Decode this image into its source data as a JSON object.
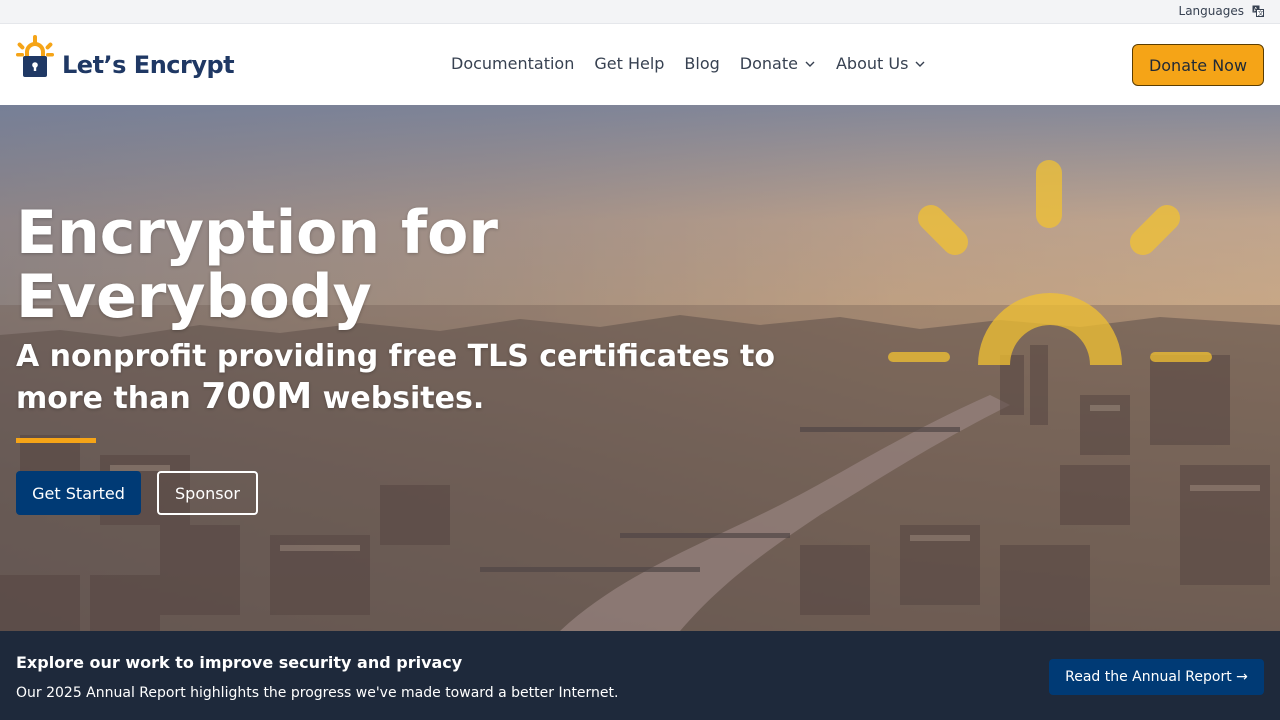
{
  "topbar": {
    "languages_label": "Languages",
    "languages_icon": "translate-icon"
  },
  "header": {
    "logo_text": "Let’s Encrypt",
    "logo_icon": "padlock-sun-icon",
    "nav": [
      {
        "label": "Documentation",
        "has_dropdown": false
      },
      {
        "label": "Get Help",
        "has_dropdown": false
      },
      {
        "label": "Blog",
        "has_dropdown": false
      },
      {
        "label": "Donate",
        "has_dropdown": true
      },
      {
        "label": "About Us",
        "has_dropdown": true
      }
    ],
    "donate_now_label": "Donate Now"
  },
  "hero": {
    "title": "Encryption for Everybody",
    "subtitle_before": "A nonprofit providing free TLS certificates to more than ",
    "subtitle_big": "700M",
    "subtitle_after": " websites.",
    "get_started_label": "Get Started",
    "sponsor_label": "Sponsor"
  },
  "banner": {
    "title": "Explore our work to improve security and privacy",
    "text": "Our 2025 Annual Report highlights the progress we've made toward a better Internet.",
    "button_label": "Read the Annual Report →"
  },
  "colors": {
    "brand_navy": "#1f3864",
    "brand_orange": "#f5a417",
    "button_blue": "#003a75",
    "banner_bg": "#1e293b"
  }
}
